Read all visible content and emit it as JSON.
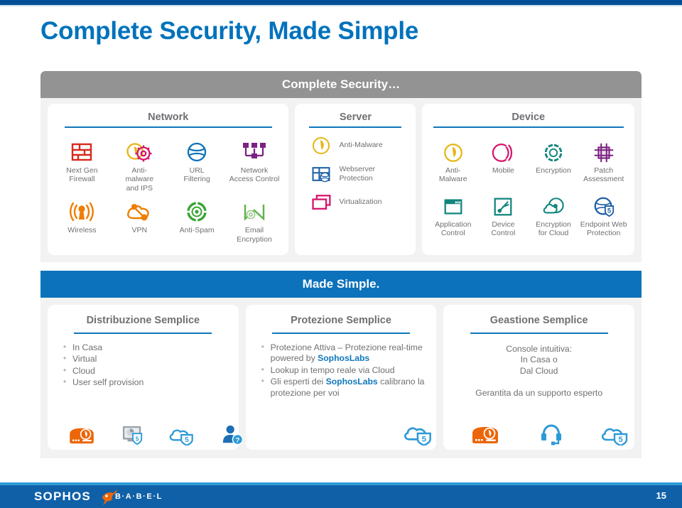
{
  "slide": {
    "title": "Complete Security, Made Simple",
    "page_number": "15"
  },
  "complete_security": {
    "band_label": "Complete Security…",
    "columns": [
      {
        "heading": "Network",
        "items": [
          {
            "label": "Next Gen\nFirewall",
            "icon": "next-gen-firewall-icon",
            "color": "#d52b1e"
          },
          {
            "label": "Anti-\nmalware\nand IPS",
            "icon": "anti-malware-ips-icon",
            "color": "#e5b611"
          },
          {
            "label": "URL\nFiltering",
            "icon": "url-filtering-icon",
            "color": "#0c72bb"
          },
          {
            "label": "Network\nAccess Control",
            "icon": "network-access-control-icon",
            "color": "#7b2382"
          },
          {
            "label": "Wireless",
            "icon": "wireless-icon",
            "color": "#f07d00"
          },
          {
            "label": "VPN",
            "icon": "vpn-icon",
            "color": "#f07d00"
          },
          {
            "label": "Anti-Spam",
            "icon": "anti-spam-icon",
            "color": "#3aa435"
          },
          {
            "label": "Email\nEncryption",
            "icon": "email-encryption-icon",
            "color": "#5eb24b"
          }
        ]
      },
      {
        "heading": "Server",
        "items": [
          {
            "label": "Anti-Malware",
            "icon": "server-anti-malware-icon",
            "color": "#e5b611"
          },
          {
            "label": "Webserver\nProtection",
            "icon": "webserver-protection-icon",
            "color": "#0c72bb"
          },
          {
            "label": "Virtualization",
            "icon": "virtualization-icon",
            "color": "#d6156c"
          }
        ]
      },
      {
        "heading": "Device",
        "items": [
          {
            "label": "Anti-\nMalware",
            "icon": "device-anti-malware-icon",
            "color": "#e5b611"
          },
          {
            "label": "Mobile",
            "icon": "mobile-icon",
            "color": "#d6156c"
          },
          {
            "label": "Encryption",
            "icon": "encryption-icon",
            "color": "#11857c"
          },
          {
            "label": "Patch\nAssessment",
            "icon": "patch-assessment-icon",
            "color": "#7b2382"
          },
          {
            "label": "Application\nControl",
            "icon": "application-control-icon",
            "color": "#11857c"
          },
          {
            "label": "Device\nControl",
            "icon": "device-control-icon",
            "color": "#11857c"
          },
          {
            "label": "Encryption\nfor Cloud",
            "icon": "encryption-for-cloud-icon",
            "color": "#11857c"
          },
          {
            "label": "Endpoint Web\nProtection",
            "icon": "endpoint-web-protection-icon",
            "color": "#1d5fa8"
          }
        ]
      }
    ]
  },
  "made_simple": {
    "band_label": "Made Simple.",
    "columns": [
      {
        "heading": "Distribuzione Semplice",
        "bullets": [
          {
            "text": "In Casa"
          },
          {
            "text": "Virtual"
          },
          {
            "text": "Cloud"
          },
          {
            "text": "User self provision"
          }
        ],
        "icons": [
          "appliance-icon",
          "monitor-shield-icon",
          "cloud-shield-icon",
          "user-question-icon"
        ]
      },
      {
        "heading": "Protezione Semplice",
        "bullets": [
          {
            "pre": "Protezione Attiva – Protezione real-time powered by ",
            "hl": "SophosLabs",
            "post": ""
          },
          {
            "pre": "Lookup in tempo reale  via Cloud",
            "hl": "",
            "post": ""
          },
          {
            "pre": "Gli esperti dei ",
            "hl": "SophosLabs",
            "post": " calibrano la protezione  per voi"
          }
        ],
        "icons": [
          "cloud-shield-icon"
        ]
      },
      {
        "heading": "Geastione Semplice",
        "center_text_1": "Console intuitiva:\nIn Casa o\nDal Cloud",
        "center_text_2": "Gerantita da un supporto esperto",
        "icons": [
          "appliance-icon",
          "headset-icon",
          "cloud-shield-icon"
        ]
      }
    ]
  },
  "footer": {
    "sophos_label": "SOPHOS",
    "babel_label": "B·A·B·E·L"
  },
  "colors": {
    "brand_blue": "#0072bc",
    "band_gray": "#939393",
    "band_blue": "#0c72bb",
    "footer_blue": "#1060a8",
    "top_strip": "#004f96",
    "orange": "#f07d00"
  }
}
